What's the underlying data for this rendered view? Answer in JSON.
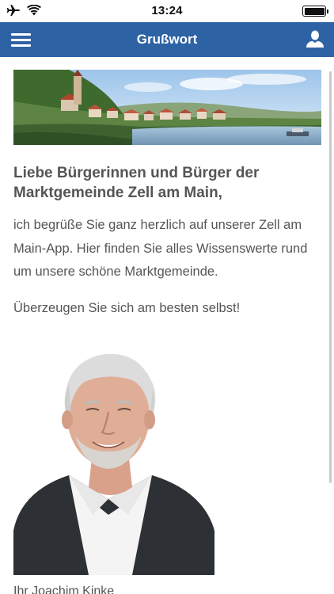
{
  "status_bar": {
    "time": "13:24",
    "icons": [
      "airplane-icon",
      "wifi-icon",
      "battery-icon"
    ]
  },
  "nav": {
    "title": "Grußwort",
    "menu_icon": "hamburger-menu-icon",
    "profile_icon": "user-icon"
  },
  "article": {
    "heading": "Liebe Bürgerinnen und Bürger der Marktgemeinde Zell am Main,",
    "paragraph1": "ich begrüße Sie ganz herzlich auf unserer Zell am Main-App. Hier finden Sie alles Wissenswerte rund um unsere schöne Marktgemeinde.",
    "paragraph2": "Überzeugen Sie sich am besten selbst!",
    "signature": "Ihr Joachim Kinke"
  },
  "colors": {
    "nav_background": "#2d63a4",
    "text": "#555555",
    "background": "#ffffff"
  }
}
